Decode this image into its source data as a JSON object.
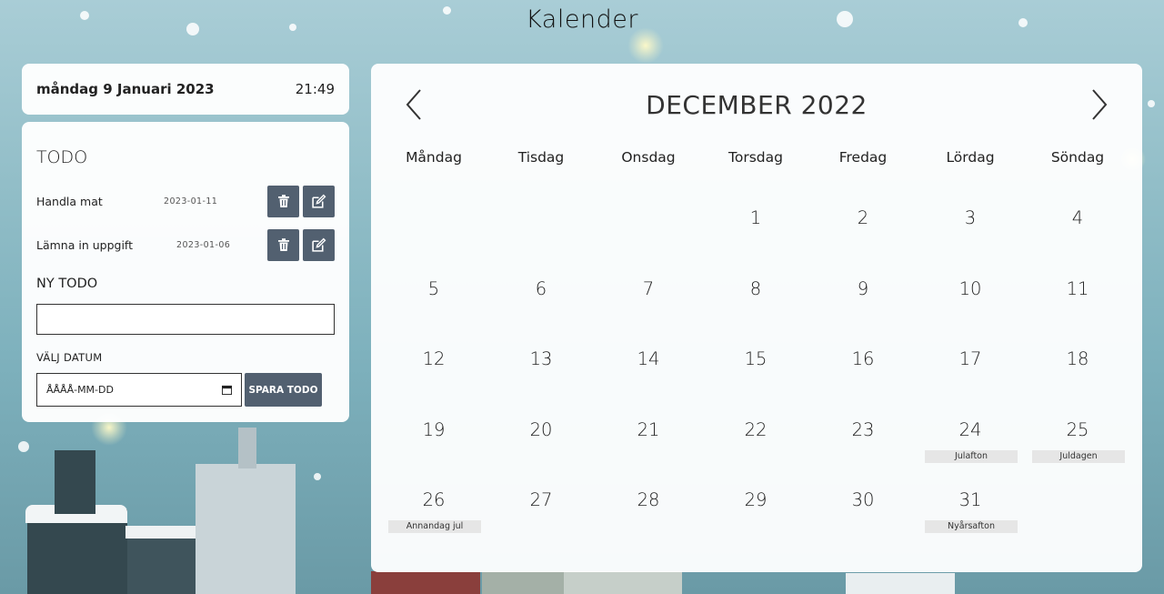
{
  "page": {
    "title": "Kalender"
  },
  "date_card": {
    "date": "måndag 9 Januari 2023",
    "time": "21:49"
  },
  "todo": {
    "heading": "TODO",
    "items": [
      {
        "name": "Handla mat",
        "due": "2023-01-11"
      },
      {
        "name": "Lämna in uppgift",
        "due": "2023-01-06"
      }
    ],
    "new_heading": "NY TODO",
    "new_input_value": "",
    "date_label": "VÄLJ DATUM",
    "date_placeholder": "ÅÅÅÅ-MM-DD",
    "save_label": "SPARA TODO",
    "delete_icon": "trash-icon",
    "edit_icon": "edit-icon"
  },
  "calendar": {
    "month_label": "DECEMBER 2022",
    "weekdays": [
      "Måndag",
      "Tisdag",
      "Onsdag",
      "Torsdag",
      "Fredag",
      "Lördag",
      "Söndag"
    ],
    "first_weekday_index": 3,
    "days_in_month": 31,
    "holidays": {
      "24": "Julafton",
      "25": "Juldagen",
      "26": "Annandag jul",
      "31": "Nyårsafton"
    }
  },
  "colors": {
    "button": "#526070",
    "holiday_bg": "#e6e6e6"
  }
}
